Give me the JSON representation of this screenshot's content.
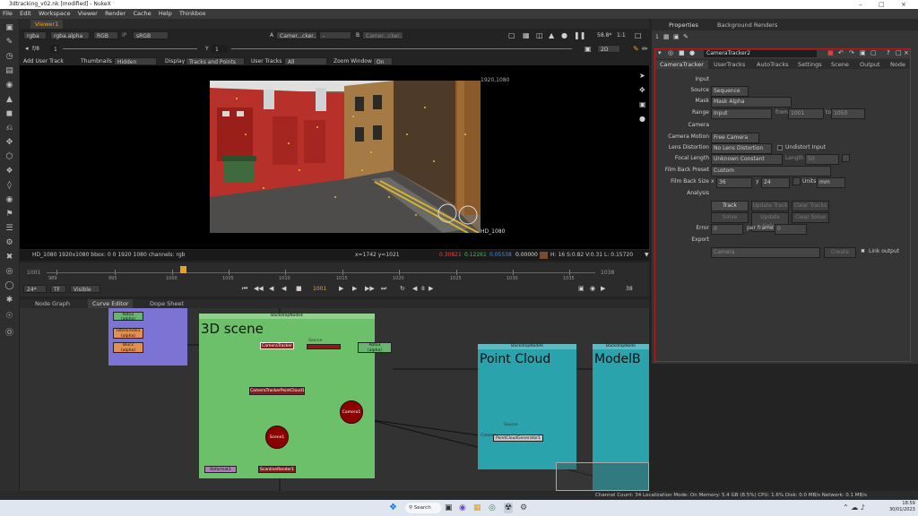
{
  "window": {
    "title": "3dtracking_v02.nk [modified] - NukeX"
  },
  "menu": [
    "File",
    "Edit",
    "Workspace",
    "Viewer",
    "Render",
    "Cache",
    "Help",
    "Thinkbox"
  ],
  "viewer_tabs": {
    "viewer1": "Viewer1"
  },
  "viewer_controls": {
    "channels": "rgba",
    "layer": "rgba.alpha",
    "display": "RGB",
    "ip": "IP",
    "colorspace": "sRGB",
    "input_a": "A",
    "input_a_node": "Camer...cker..",
    "dash": "-",
    "input_b": "B",
    "input_b_node": "Camer...cker..",
    "zoom": "58.8*",
    "ratio": "1:1",
    "view": "2D",
    "frame_step": "f/8",
    "frame": "1",
    "y": "Y",
    "y_value": "1"
  },
  "overlay_controls": {
    "add_user_track": "Add User Track",
    "thumbnails_label": "Thumbnails",
    "thumbnails": "Hidden",
    "display_label": "Display",
    "display": "Tracks and Points",
    "user_tracks_label": "User Tracks",
    "user_tracks": "All",
    "zoom_window_label": "Zoom Window",
    "zoom_window": "On"
  },
  "viewer": {
    "format_corner": "1920,1080",
    "format_label": "HD_1080"
  },
  "viewer_info": {
    "left": "HD_1080 1920x1080  bbox: 0 0 1920 1080 channels: rgb",
    "coords": "x=1742 y=1021",
    "r": "0.30821",
    "g": "0.12261",
    "b": "0.05538",
    "a": "0.00000",
    "hsv": "H: 16 S:0.82 V:0.31  L: 0.15720"
  },
  "timeline": {
    "start": "1001",
    "end": "1038",
    "ticks": [
      "989",
      "995",
      "1000",
      "1005",
      "1010",
      "1015",
      "1020",
      "1025",
      "1030",
      "1035"
    ],
    "current": "1001",
    "fps": "24*",
    "tf": "TF",
    "visible": "Visible",
    "step": "8",
    "end_field": "38"
  },
  "graph_tabs": {
    "node_graph": "Node Graph",
    "curve_editor": "Curve Editor",
    "dope_sheet": "Dope Sheet"
  },
  "graph": {
    "backdrop1": {
      "title": "BackdropNode4",
      "label": "3D scene"
    },
    "backdrop2": {
      "title": "BackdropNode6",
      "label": "Point Cloud"
    },
    "backdrop3": {
      "title": "BackdropNode",
      "label": "ModelB"
    },
    "nodes": {
      "roto2": "Roto2",
      "roto2_sub": "(alpha)",
      "filtererode": "FilterErode1",
      "filtererode_sub": "(alpha)",
      "blur2": "Blur2",
      "blur2_sub": "(alpha)",
      "cameratracker": "CameraTracker",
      "source": "Source",
      "roto3": "Roto3",
      "roto3_sub": "(alpha)",
      "cameratrackerpointcloud": "CameraTrackerPointCloud1",
      "camera": "Camera1",
      "scene": "Scene1",
      "scanline": "ScanlineRender1",
      "reformat": "Reformat1",
      "pointcloud": "PointCloudGenerator1",
      "source2": "Source",
      "camera_in": "Camera"
    }
  },
  "props": {
    "tabs": {
      "properties": "Properties",
      "background_renders": "Background Renders"
    },
    "count": "1",
    "node_name": "CameraTracker2",
    "subtabs": [
      "CameraTracker",
      "UserTracks",
      "AutoTracks",
      "Settings",
      "Scene",
      "Output",
      "Node"
    ],
    "input_section": "Input",
    "source_label": "Source",
    "source": "Sequence",
    "mask_label": "Mask",
    "mask": "Mask Alpha",
    "range_label": "Range",
    "range": "Input",
    "from_label": "from",
    "from": "1001",
    "to_label": "to",
    "to": "1050",
    "camera_section": "Camera",
    "motion_label": "Camera Motion",
    "motion": "Free Camera",
    "lens_label": "Lens Distortion",
    "lens": "No Lens Distortion",
    "undistort": "Undistort Input",
    "focal_label": "Focal Length",
    "focal": "Unknown Constant",
    "length_label": "Length",
    "length": "50",
    "filmback_preset_label": "Film Back Preset",
    "filmback_preset": "Custom",
    "filmback_size_label": "Film Back Size",
    "x": "x",
    "fb_x": "36",
    "y": "y",
    "fb_y": "24",
    "units_label": "Units",
    "units": "mm",
    "analysis_section": "Analysis",
    "track": "Track",
    "update_track": "Update Track",
    "clear_tracks": "Clear Tracks",
    "solve": "Solve",
    "update_solve": "Update Solve",
    "clear_solve": "Clear Solve",
    "error_label": "Error",
    "error": "0",
    "per_frame_label": "per frame",
    "per_frame": "0",
    "export_section": "Export",
    "export_type": "Camera",
    "create": "Create",
    "link_output": "Link output"
  },
  "status": {
    "text": "Channel Count: 34  Localization Mode: On  Memory: 5.4 GB (8.5%)  CPU: 1.6%  Disk: 0.0 MB/s  Network: 0.1 MB/s"
  },
  "taskbar": {
    "search": "Search",
    "time": "18:59",
    "date": "30/01/2023"
  },
  "colors": {
    "accent": "#f0a020",
    "selected_node_border": "#c41e1e",
    "backdrop_green": "#6dc06a",
    "backdrop_teal": "#2aa3ad",
    "backdrop_purple": "#7b74d4"
  }
}
